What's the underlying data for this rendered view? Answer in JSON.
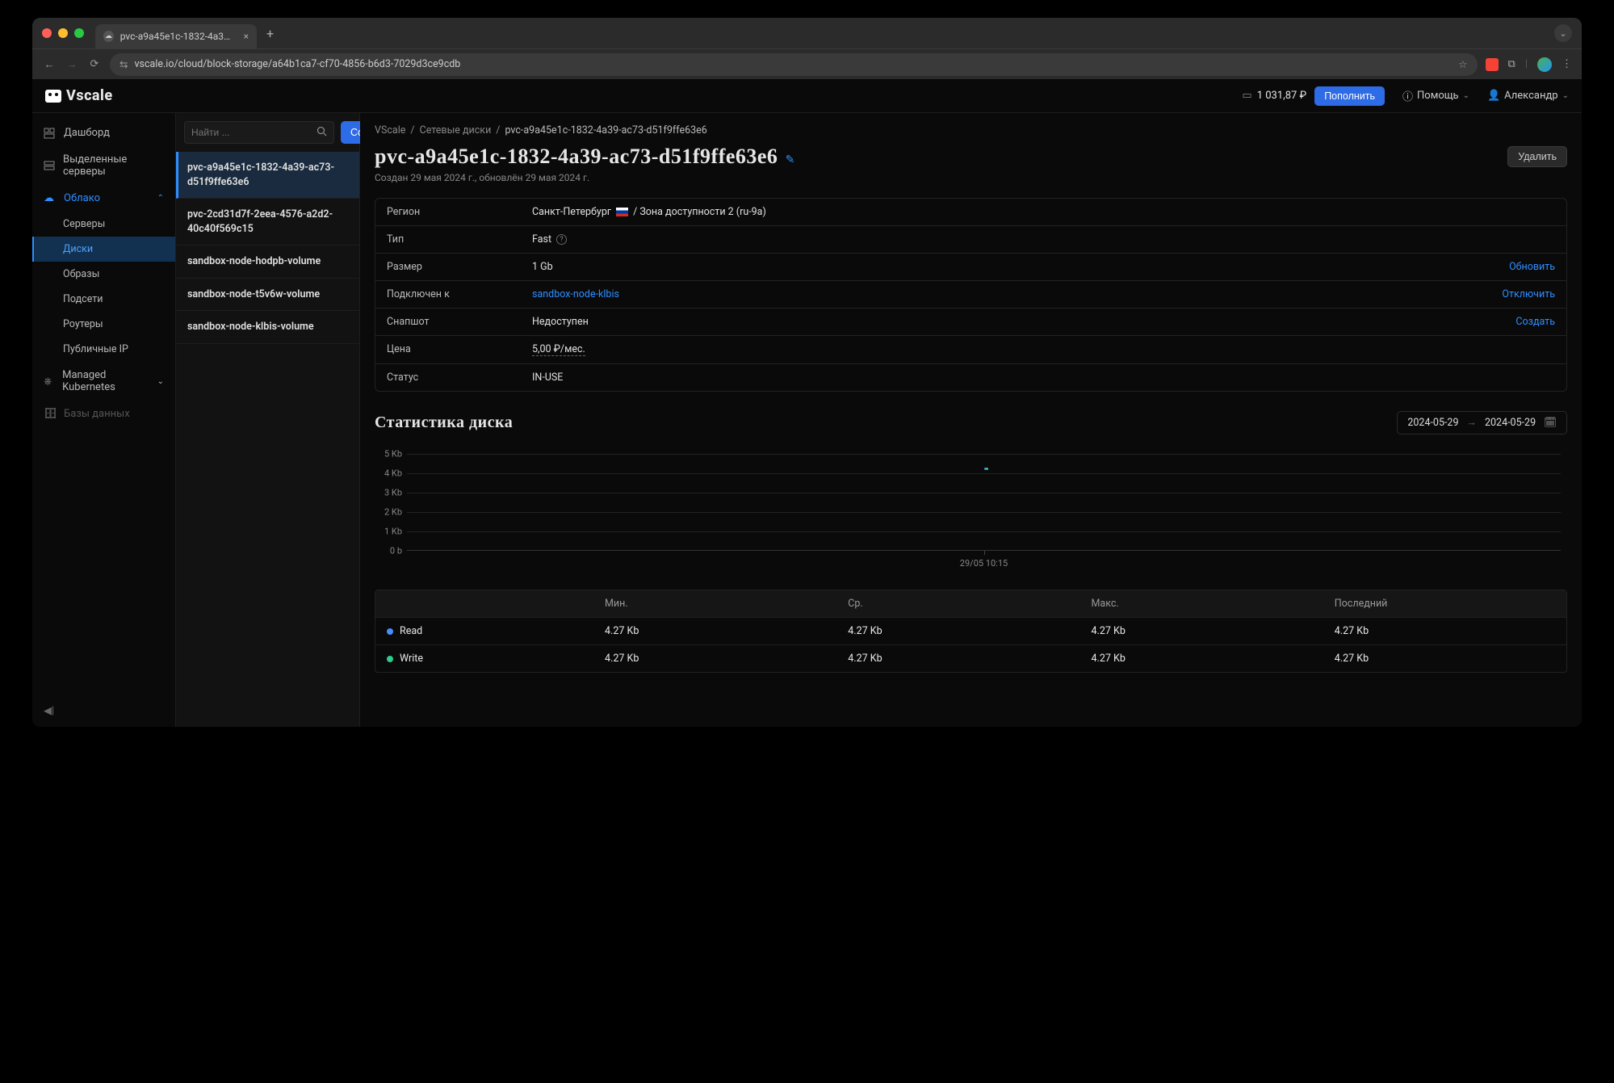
{
  "browser": {
    "tab_title": "pvc-a9a45e1c-1832-4a39-a…",
    "url": "vscale.io/cloud/block-storage/a64b1ca7-cf70-4856-b6d3-7029d3ce9cdb"
  },
  "header": {
    "logo": "Vscale",
    "balance": "1 031,87 ₽",
    "topup": "Пополнить",
    "help": "Помощь",
    "user": "Александр"
  },
  "sidebar": {
    "items": [
      {
        "label": "Дашборд"
      },
      {
        "label": "Выделенные серверы"
      },
      {
        "label": "Облако"
      },
      {
        "label": "Managed Kubernetes"
      },
      {
        "label": "Базы данных"
      }
    ],
    "cloud_sub": [
      {
        "label": "Серверы"
      },
      {
        "label": "Диски"
      },
      {
        "label": "Образы"
      },
      {
        "label": "Подсети"
      },
      {
        "label": "Роутеры"
      },
      {
        "label": "Публичные IP"
      }
    ]
  },
  "disklist": {
    "search_placeholder": "Найти ...",
    "create": "Создать",
    "items": [
      "pvc-a9a45e1c-1832-4a39-ac73-d51f9ffe63e6",
      "pvc-2cd31d7f-2eea-4576-a2d2-40c40f569c15",
      "sandbox-node-hodpb-volume",
      "sandbox-node-t5v6w-volume",
      "sandbox-node-klbis-volume"
    ]
  },
  "breadcrumb": [
    "VScale",
    "Сетевые диски",
    "pvc-a9a45e1c-1832-4a39-ac73-d51f9ffe63e6"
  ],
  "page_title": "pvc-a9a45e1c-1832-4a39-ac73-d51f9ffe63e6",
  "delete": "Удалить",
  "subtitle": "Создан 29 мая 2024 г., обновлён 29 мая 2024 г.",
  "info": {
    "region_label": "Регион",
    "region_val1": "Санкт-Петербург",
    "region_val2": "/ Зона доступности 2 (ru-9a)",
    "type_label": "Тип",
    "type_val": "Fast",
    "size_label": "Размер",
    "size_val": "1 Gb",
    "size_action": "Обновить",
    "attached_label": "Подключен к",
    "attached_val": "sandbox-node-klbis",
    "attached_action": "Отключить",
    "snapshot_label": "Снапшот",
    "snapshot_val": "Недоступен",
    "snapshot_action": "Создать",
    "price_label": "Цена",
    "price_val": "5,00 ₽/мес.",
    "status_label": "Статус",
    "status_val": "IN-USE"
  },
  "stats": {
    "title": "Статистика диска",
    "date_from": "2024-05-29",
    "date_to": "2024-05-29",
    "cols": [
      "Мин.",
      "Ср.",
      "Макс.",
      "Последний"
    ],
    "rows": [
      {
        "name": "Read",
        "vals": [
          "4.27 Kb",
          "4.27 Kb",
          "4.27 Kb",
          "4.27 Kb"
        ]
      },
      {
        "name": "Write",
        "vals": [
          "4.27 Kb",
          "4.27 Kb",
          "4.27 Kb",
          "4.27 Kb"
        ]
      }
    ]
  },
  "chart_data": {
    "type": "line",
    "title": "",
    "xlabel": "",
    "ylabel": "",
    "ylim": [
      0,
      5
    ],
    "yunit": "Kb",
    "yticks": [
      "0 b",
      "1 Kb",
      "2 Kb",
      "3 Kb",
      "4 Kb",
      "5 Kb"
    ],
    "xticks": [
      "29/05 10:15"
    ],
    "series": [
      {
        "name": "Read",
        "color": "#4a8cff",
        "x": [
          "29/05 10:15"
        ],
        "values": [
          4.27
        ]
      },
      {
        "name": "Write",
        "color": "#2ecc8e",
        "x": [
          "29/05 10:15"
        ],
        "values": [
          4.27
        ]
      }
    ]
  }
}
